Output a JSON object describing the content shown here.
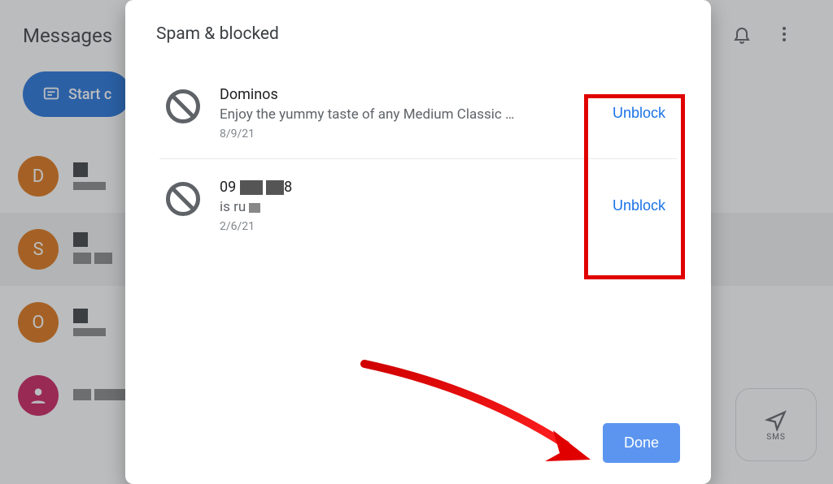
{
  "bg": {
    "app_title": "Messages",
    "start_chat": "Start c",
    "rows": [
      {
        "letter": "D"
      },
      {
        "letter": "S"
      },
      {
        "letter": "O"
      },
      {
        "letter": ""
      }
    ],
    "sms_label": "SMS"
  },
  "modal": {
    "title": "Spam & blocked",
    "entries": [
      {
        "sender_a": "Dominos",
        "sender_b": "",
        "preview_a": "Enjoy the yummy taste of any Medium Classic …",
        "preview_b": "",
        "date": "8/9/21",
        "action": "Unblock"
      },
      {
        "sender_a": "09",
        "sender_b": "8",
        "preview_a": "is ru",
        "preview_b": "",
        "date": "2/6/21",
        "action": "Unblock"
      }
    ],
    "done": "Done"
  }
}
